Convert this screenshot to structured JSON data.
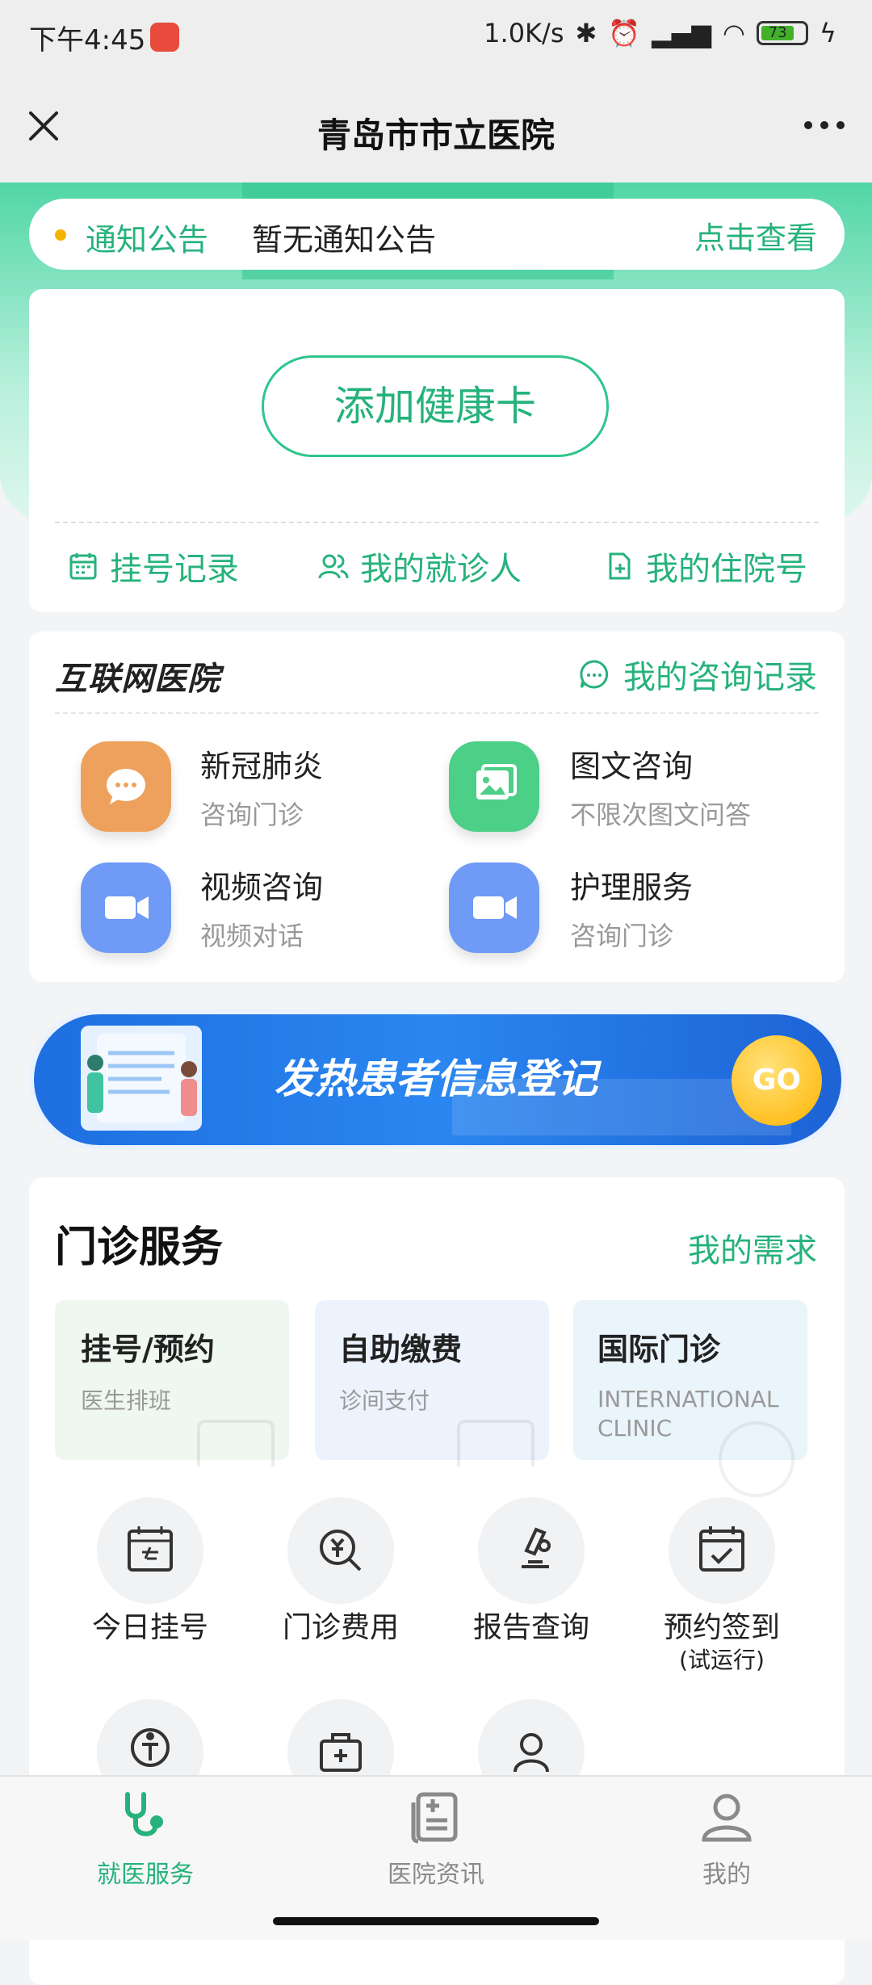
{
  "status": {
    "time": "下午4:45",
    "speed": "1.0K/s",
    "battery": "73"
  },
  "nav": {
    "title": "青岛市市立医院"
  },
  "notice": {
    "label": "通知公告",
    "text": "暂无通知公告",
    "link": "点击查看"
  },
  "health_card": {
    "add_button": "添加健康卡",
    "links": [
      "挂号记录",
      "我的就诊人",
      "我的住院号"
    ]
  },
  "internet_hospital": {
    "logo": "互联网医院",
    "record_link": "我的咨询记录",
    "services": [
      {
        "title": "新冠肺炎",
        "sub": "咨询门诊",
        "color": "#eea15c"
      },
      {
        "title": "图文咨询",
        "sub": "不限次图文问答",
        "color": "#4ccf86"
      },
      {
        "title": "视频咨询",
        "sub": "视频对话",
        "color": "#6f9af5"
      },
      {
        "title": "护理服务",
        "sub": "咨询门诊",
        "color": "#6f9af5"
      }
    ]
  },
  "banner": {
    "text": "发热患者信息登记",
    "go": "GO"
  },
  "outpatient": {
    "title": "门诊服务",
    "need_link": "我的需求",
    "tiles": [
      {
        "title": "挂号/预约",
        "sub": "医生排班",
        "bg": "#eef8f1"
      },
      {
        "title": "自助缴费",
        "sub": "诊间支付",
        "bg": "#edf3fd"
      },
      {
        "title": "国际门诊",
        "sub": "INTERNATIONAL CLINIC",
        "bg": "#eaf4fb"
      }
    ],
    "grid": [
      {
        "label": "今日挂号",
        "icon": "calendar-today-icon"
      },
      {
        "label": "门诊费用",
        "icon": "yuan-search-icon"
      },
      {
        "label": "报告查询",
        "icon": "microscope-icon"
      },
      {
        "label": "预约签到",
        "sub": "(试运行)",
        "icon": "calendar-check-icon"
      }
    ]
  },
  "tabbar": {
    "tabs": [
      {
        "label": "就医服务",
        "active": true
      },
      {
        "label": "医院资讯",
        "active": false
      },
      {
        "label": "我的",
        "active": false
      }
    ],
    "active_color": "#26b27d",
    "inactive_color": "#8a8a8a"
  }
}
